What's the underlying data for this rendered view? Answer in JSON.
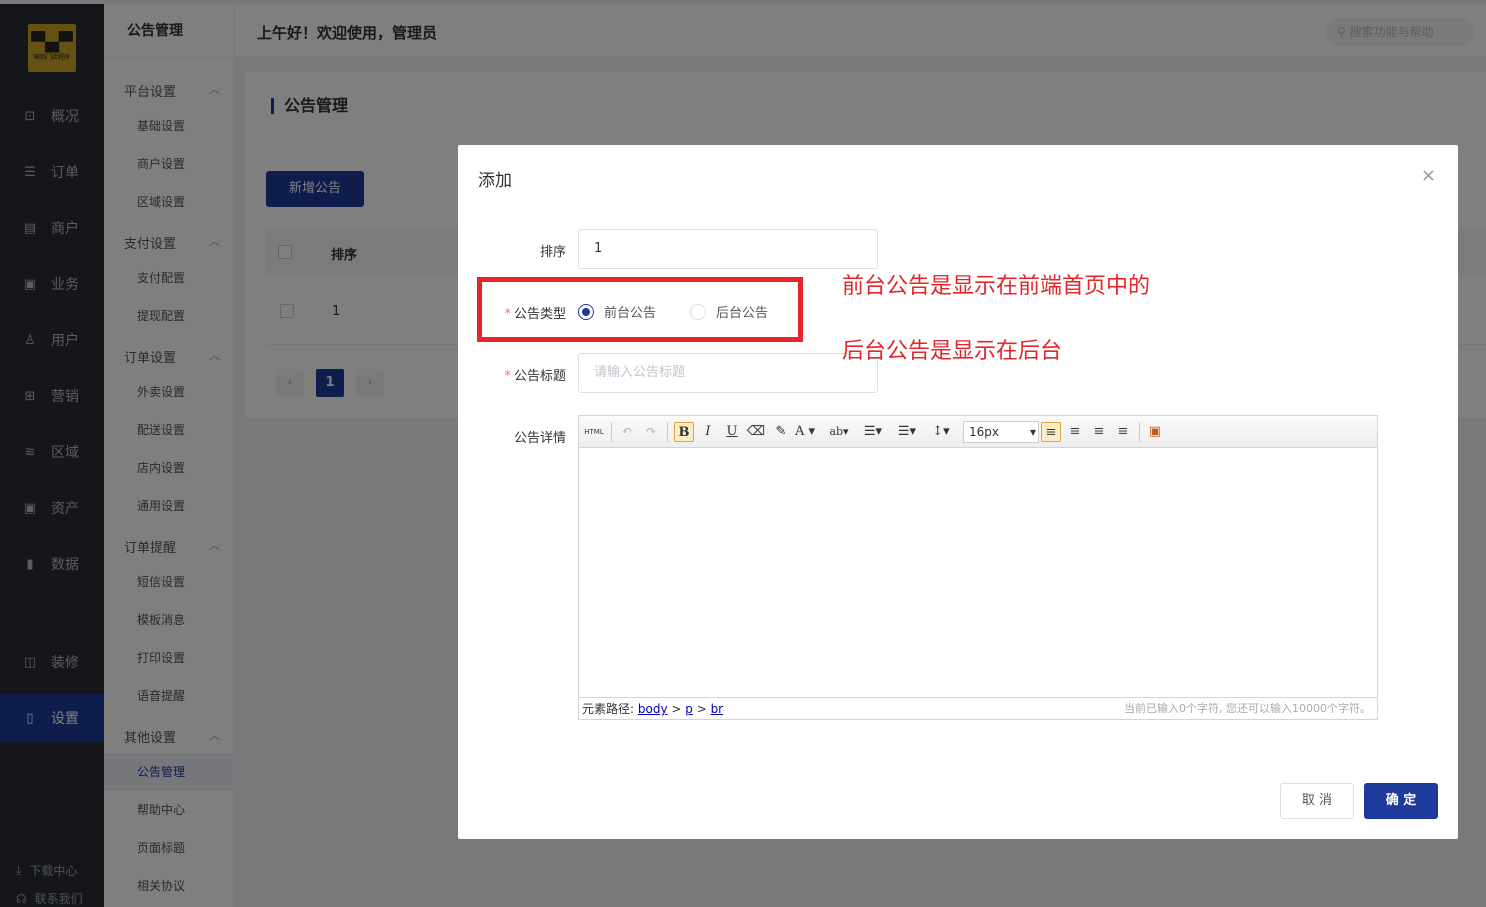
{
  "nav": {
    "logo_text": "邮购门店程序",
    "items": [
      {
        "label": "概况",
        "icon": "monitor-icon"
      },
      {
        "label": "订单",
        "icon": "order-icon"
      },
      {
        "label": "商户",
        "icon": "store-icon"
      },
      {
        "label": "业务",
        "icon": "briefcase-icon"
      },
      {
        "label": "用户",
        "icon": "user-icon"
      },
      {
        "label": "营销",
        "icon": "marketing-icon"
      },
      {
        "label": "区域",
        "icon": "database-icon"
      },
      {
        "label": "资产",
        "icon": "wallet-icon"
      },
      {
        "label": "数据",
        "icon": "chart-icon"
      },
      {
        "label": "装修",
        "icon": "bag-icon"
      },
      {
        "label": "设置",
        "icon": "phone-icon"
      }
    ],
    "active": "设置",
    "footer": [
      {
        "label": "下载中心",
        "icon": "download-icon"
      },
      {
        "label": "联系我们",
        "icon": "headset-icon"
      }
    ]
  },
  "subnav": {
    "title": "公告管理",
    "groups": [
      {
        "label": "平台设置",
        "items": [
          "基础设置",
          "商户设置",
          "区域设置"
        ]
      },
      {
        "label": "支付设置",
        "items": [
          "支付配置",
          "提现配置"
        ]
      },
      {
        "label": "订单设置",
        "items": [
          "外卖设置",
          "配送设置",
          "店内设置",
          "通用设置"
        ]
      },
      {
        "label": "订单提醒",
        "items": [
          "短信设置",
          "模板消息",
          "打印设置",
          "语音提醒"
        ]
      },
      {
        "label": "其他设置",
        "items": [
          "公告管理",
          "帮助中心",
          "页面标题",
          "相关协议"
        ]
      }
    ],
    "active": "公告管理"
  },
  "topbar": {
    "greeting": "上午好！欢迎使用，管理员",
    "search_placeholder": "搜索功能与帮助"
  },
  "page": {
    "title": "公告管理",
    "add_button": "新增公告",
    "table": {
      "headers": [
        "排序"
      ],
      "rows": [
        [
          "1"
        ]
      ]
    },
    "pagination": {
      "prev": "‹",
      "current": "1",
      "next": "›"
    }
  },
  "dialog": {
    "title": "添加",
    "close": "×",
    "fields": {
      "sort_label": "排序",
      "sort_value": "1",
      "type_label": "公告类型",
      "type_options": [
        "前台公告",
        "后台公告"
      ],
      "type_selected": "前台公告",
      "title_label": "公告标题",
      "title_placeholder": "请输入公告标题",
      "detail_label": "公告详情"
    },
    "editor": {
      "font_size": "16px",
      "path_label": "元素路径:",
      "path": [
        "body",
        "p",
        "br"
      ],
      "counter": "当前已输入0个字符, 您还可以输入10000个字符。",
      "tools": {
        "html": "HTML",
        "bold": "B",
        "italic": "I",
        "underline": "U",
        "font_color": "A"
      }
    },
    "cancel": "取 消",
    "confirm": "确 定"
  },
  "annotations": {
    "line1": "前台公告是显示在前端首页中的",
    "line2": "后台公告是显示在后台",
    "color": "#e3262b"
  },
  "colors": {
    "primary": "#1e3a9a",
    "sidebar": "#282c34"
  }
}
